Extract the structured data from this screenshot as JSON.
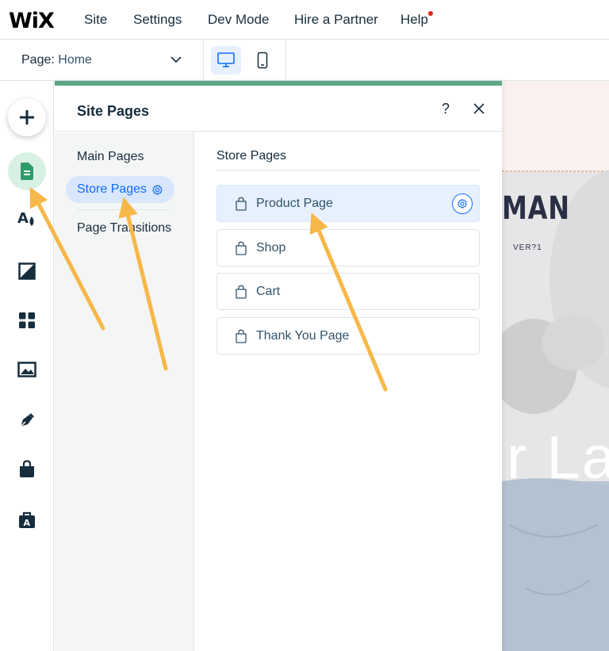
{
  "topbar": {
    "logo": "WiX",
    "menu": [
      "Site",
      "Settings",
      "Dev Mode",
      "Hire a Partner",
      "Help"
    ]
  },
  "secondbar": {
    "page_key": "Page:",
    "page_value": "Home"
  },
  "left_toolbar": {
    "tools": [
      "add-icon",
      "pages-icon",
      "theme-icon",
      "background-icon",
      "apps-icon",
      "media-icon",
      "blog-icon",
      "store-icon",
      "business-icon"
    ]
  },
  "panel": {
    "title": "Site Pages",
    "help_label": "?",
    "side_items": {
      "main": "Main Pages",
      "store": "Store Pages",
      "transitions": "Page Transitions"
    },
    "section_title": "Store Pages",
    "pages": [
      {
        "label": "Product Page",
        "selected": true
      },
      {
        "label": "Shop",
        "selected": false
      },
      {
        "label": "Cart",
        "selected": false
      },
      {
        "label": "Thank You Page",
        "selected": false
      }
    ]
  },
  "canvas": {
    "brand_text": "MAN",
    "sub_text": "VER?1",
    "headline": "r La"
  },
  "colors": {
    "accent": "#116dff",
    "panel_strip": "#5aa887",
    "annotation_arrow": "#f7b84a"
  }
}
